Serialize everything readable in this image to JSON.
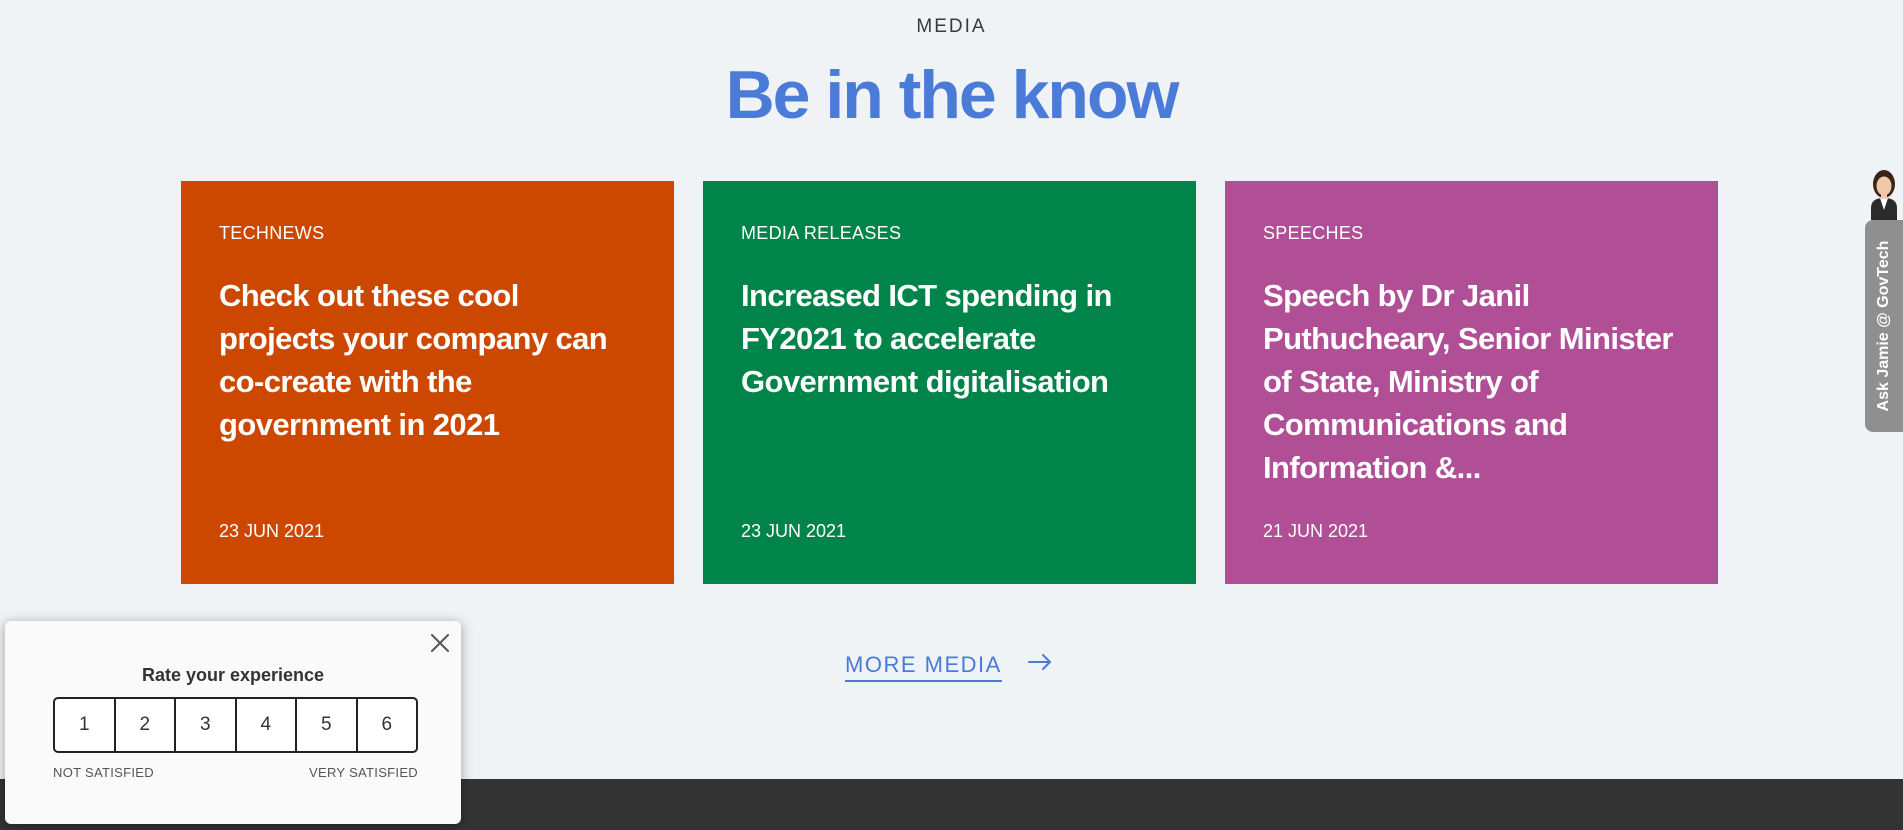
{
  "section": {
    "eyebrow": "MEDIA",
    "headline": "Be in the know"
  },
  "cards": [
    {
      "category": "TECHNEWS",
      "title": "Check out these cool projects your company can co-create with the government in 2021",
      "date": "23 JUN 2021",
      "color": "#cc4800"
    },
    {
      "category": "MEDIA RELEASES",
      "title": "Increased ICT spending in FY2021 to accelerate Government digitalisation",
      "date": "23 JUN 2021",
      "color": "#00844a"
    },
    {
      "category": "SPEECHES",
      "title": "Speech by Dr Janil Puthucheary, Senior Minister of State, Ministry of Communications and Information &...",
      "date": "21 JUN 2021",
      "color": "#b04f96"
    }
  ],
  "more_media": {
    "label": "MORE MEDIA",
    "icon": "arrow-right-icon"
  },
  "chat_widget": {
    "label": "Ask Jamie @ GovTech",
    "icon": "assistant-avatar"
  },
  "rating": {
    "title": "Rate your experience",
    "options": [
      "1",
      "2",
      "3",
      "4",
      "5",
      "6"
    ],
    "low_label": "NOT SATISFIED",
    "high_label": "VERY SATISFIED",
    "close_icon": "close-icon"
  },
  "colors": {
    "accent": "#4a7bd9",
    "background": "#eff3f6",
    "footer": "#333333"
  }
}
